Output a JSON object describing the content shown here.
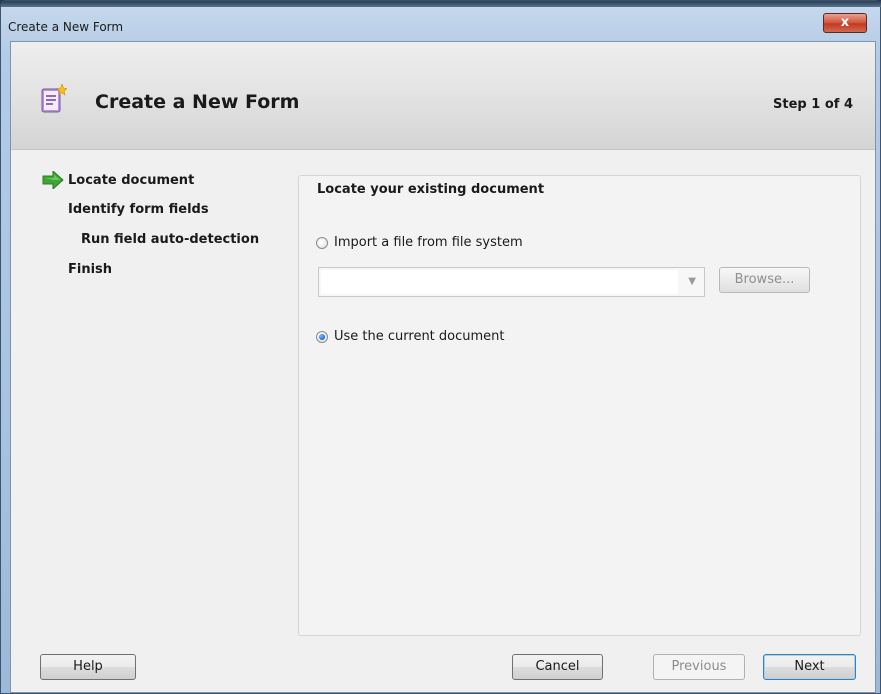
{
  "window": {
    "title": "Create a New Form",
    "close_label": "x"
  },
  "header": {
    "title": "Create a New Form",
    "step": "Step 1 of 4",
    "icon": "form-icon"
  },
  "steps": [
    {
      "label": "Locate document",
      "current": true
    },
    {
      "label": "Identify form fields",
      "current": false
    },
    {
      "label": "Run field auto-detection",
      "current": false
    },
    {
      "label": "Finish",
      "current": false
    }
  ],
  "panel": {
    "title": "Locate your existing document",
    "option_import": "Import a file from file system",
    "option_current": "Use the current document",
    "selected_option": "current",
    "file_path_value": "",
    "browse_label": "Browse..."
  },
  "footer": {
    "help_label": "Help",
    "cancel_label": "Cancel",
    "previous_label": "Previous",
    "next_label": "Next"
  },
  "colors": {
    "arrow_green": "#3fa535",
    "accent_blue": "#1a66c4"
  }
}
